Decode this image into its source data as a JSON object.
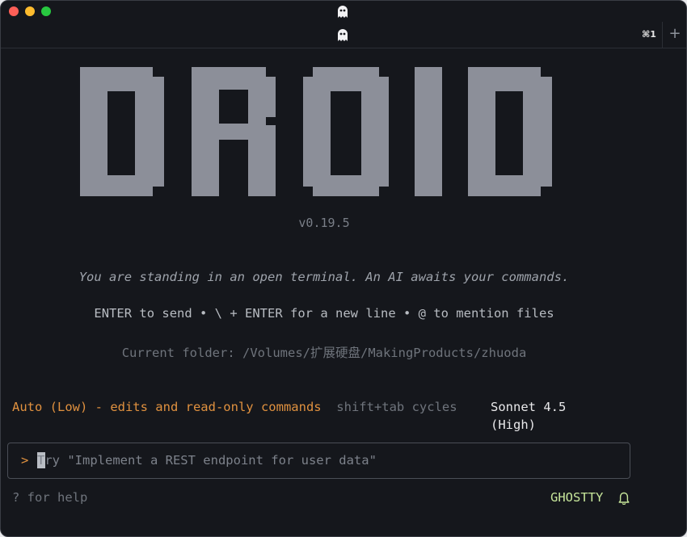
{
  "window": {
    "tab_shortcut": "⌘1",
    "new_tab_label": "+"
  },
  "splash": {
    "logo_text": "DROID",
    "version": "v0.19.5",
    "tagline": "You are standing in an open terminal. An AI awaits your commands.",
    "hints": "ENTER to send • \\ + ENTER for a new line • @ to mention files",
    "folder": "Current folder: /Volumes/扩展硬盘/MakingProducts/zhuoda"
  },
  "status": {
    "mode": "Auto (Low) - edits and read-only commands",
    "mode_hint": "shift+tab cycles",
    "model": "Sonnet 4.5 (High)"
  },
  "input": {
    "prompt_symbol": ">",
    "placeholder": "Try \"Implement a REST endpoint for user data\""
  },
  "footer": {
    "help": "? for help",
    "app_name": "GHOSTTY"
  },
  "colors": {
    "background": "#15171c",
    "accent_orange": "#e0913f",
    "logo_gray": "#8c8f99",
    "ghostty_green": "#c6e59a"
  },
  "icons": {
    "title": "ghost-icon",
    "tab": "ghost-icon",
    "footer": "bell-icon"
  }
}
